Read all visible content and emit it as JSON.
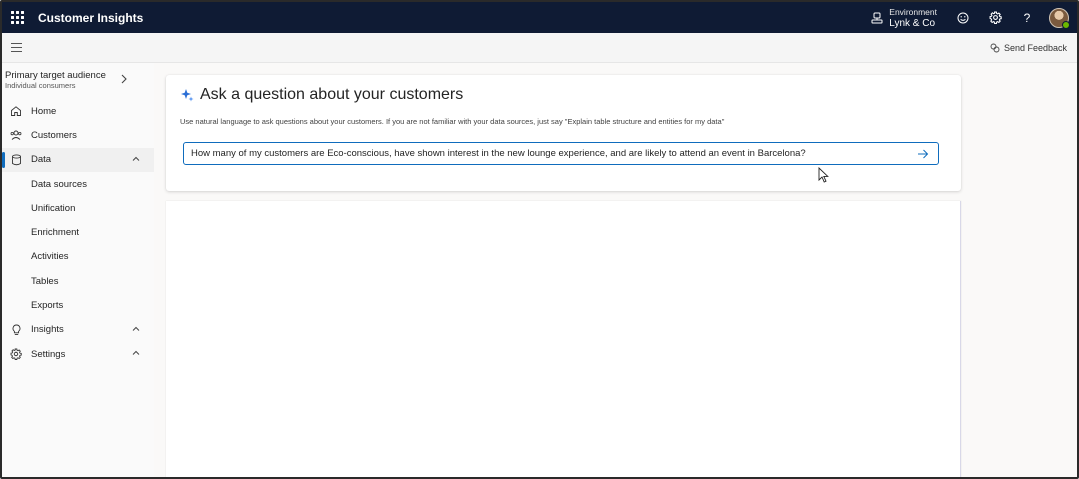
{
  "header": {
    "app_title": "Customer Insights",
    "environment_label": "Environment",
    "environment_value": "Lynk & Co",
    "help_label": "?"
  },
  "cmdbar": {
    "feedback_label": "Send Feedback"
  },
  "sidebar": {
    "audience_title": "Primary target audience",
    "audience_subtitle": "Individual consumers",
    "items": [
      {
        "label": "Home",
        "icon": "home-icon"
      },
      {
        "label": "Customers",
        "icon": "customers-icon"
      },
      {
        "label": "Data",
        "icon": "database-icon",
        "active": true,
        "expanded": true
      },
      {
        "label": "Data sources"
      },
      {
        "label": "Unification"
      },
      {
        "label": "Enrichment"
      },
      {
        "label": "Activities"
      },
      {
        "label": "Tables"
      },
      {
        "label": "Exports"
      },
      {
        "label": "Insights",
        "icon": "lightbulb-icon"
      },
      {
        "label": "Settings",
        "icon": "gear-icon"
      }
    ]
  },
  "ask": {
    "title": "Ask a question about your customers",
    "description": "Use natural language to ask questions about your customers. If you are not familiar with your data sources, just say \"Explain table structure and entities for my data\"",
    "query": "How many of my customers are Eco-conscious, have shown interest in the new lounge experience, and are likely to attend an event in Barcelona?"
  },
  "colors": {
    "topbar": "#0f1b34",
    "accent": "#0f6cbd",
    "presence": "#6bb700"
  }
}
